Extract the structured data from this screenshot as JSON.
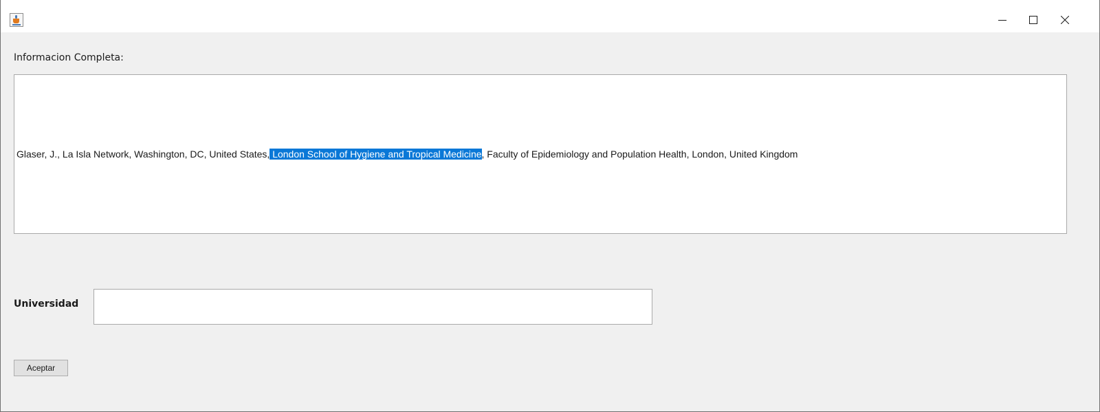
{
  "window": {
    "title": "",
    "controls": {
      "minimize_icon": "minimize-icon",
      "maximize_icon": "maximize-icon",
      "close_icon": "close-icon"
    }
  },
  "form": {
    "info_label": "Informacion Completa:",
    "info_text": {
      "before": "Glaser, J., La Isla Network, Washington, DC, United States,",
      "selected": " London School of Hygiene and Tropical Medicine",
      "after": ", Faculty of Epidemiology and Population Health, London, United Kingdom"
    },
    "university_label": "Universidad",
    "university_value": "",
    "accept_label": "Aceptar"
  },
  "colors": {
    "selection": "#0a78d7",
    "background": "#f0f0f0"
  }
}
